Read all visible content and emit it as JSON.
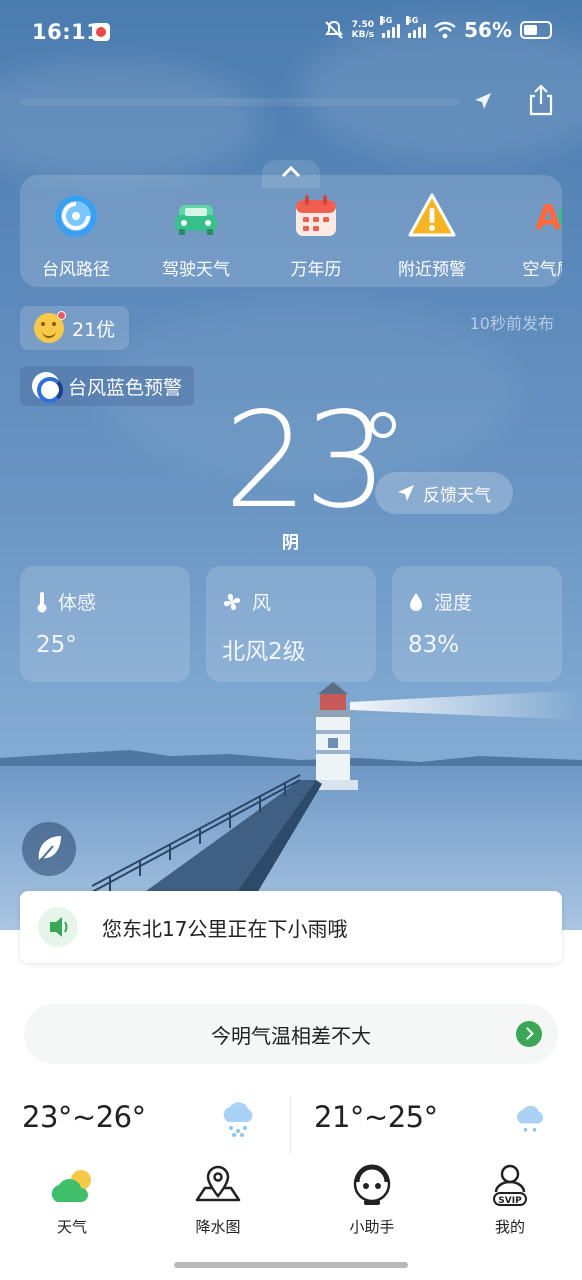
{
  "status_bar": {
    "time": "16:11",
    "net_speed_value": "7.50",
    "net_speed_unit": "KB/s",
    "sim1": "5G",
    "sim2": "5G",
    "battery_text": "56%",
    "battery_level": 0.56
  },
  "quick_links": [
    {
      "label": "台风路径",
      "icon": "typhoon-icon"
    },
    {
      "label": "驾驶天气",
      "icon": "car-icon"
    },
    {
      "label": "万年历",
      "icon": "calendar-icon"
    },
    {
      "label": "附近预警",
      "icon": "warning-icon"
    },
    {
      "label": "空气质",
      "icon": "aqi-icon"
    }
  ],
  "aqi": {
    "value": "21",
    "level": "优",
    "text": "21优"
  },
  "publish_time": "10秒前发布",
  "warning": {
    "text": "台风蓝色预警",
    "icon": "typhoon-warning-icon"
  },
  "current": {
    "temperature": "23",
    "condition": "阴",
    "feedback_label": "反馈天气"
  },
  "details": [
    {
      "label": "体感",
      "value": "25°",
      "icon": "thermometer-icon"
    },
    {
      "label": "风",
      "value": "北风2级",
      "icon": "fan-icon"
    },
    {
      "label": "湿度",
      "value": "83%",
      "icon": "droplet-icon"
    }
  ],
  "rain_alert": "您东北17公里正在下小雨哦",
  "tip": "今明气温相差不大",
  "forecast": [
    {
      "range": "23°~26°",
      "icon": "rain-cloud-icon"
    },
    {
      "range": "21°~25°",
      "icon": "rain-cloud-icon"
    }
  ],
  "tabs": [
    {
      "label": "天气",
      "icon": "weather-tab-icon"
    },
    {
      "label": "降水图",
      "icon": "precip-map-icon"
    },
    {
      "label": "小助手",
      "icon": "assistant-icon"
    },
    {
      "label": "我的",
      "icon": "profile-icon"
    }
  ],
  "profile_badge": "SVIP",
  "colors": {
    "accent_green": "#3aa656",
    "sky_top": "#4b7cb0",
    "sky_bottom": "#8fb4d8"
  }
}
